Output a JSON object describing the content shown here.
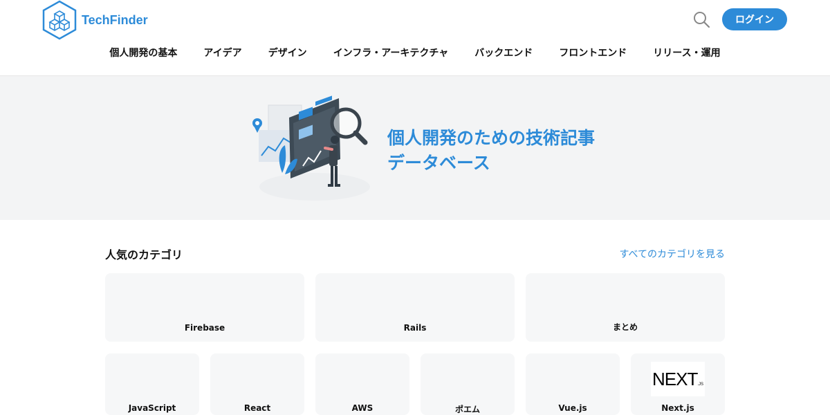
{
  "header": {
    "brand": "TechFinder",
    "login_label": "ログイン",
    "brand_color": "#2d8bd8"
  },
  "nav": {
    "items": [
      {
        "label": "個人開発の基本"
      },
      {
        "label": "アイデア"
      },
      {
        "label": "デザイン"
      },
      {
        "label": "インフラ・アーキテクチャ"
      },
      {
        "label": "バックエンド"
      },
      {
        "label": "フロントエンド"
      },
      {
        "label": "リリース・運用"
      }
    ]
  },
  "hero": {
    "title_line1": "個人開発のための技術記事",
    "title_line2": "データベース"
  },
  "categories": {
    "heading": "人気のカテゴリ",
    "see_all_label": "すべてのカテゴリを見る",
    "row1": [
      {
        "label": "Firebase"
      },
      {
        "label": "Rails"
      },
      {
        "label": "まとめ"
      }
    ],
    "row2": [
      {
        "label": "JavaScript"
      },
      {
        "label": "React"
      },
      {
        "label": "AWS"
      },
      {
        "label": "ポエム"
      },
      {
        "label": "Vue.js"
      },
      {
        "label": "Next.js",
        "logo_text": "NEXT",
        "logo_suffix": ".JS"
      }
    ]
  },
  "icons": [
    "cube-logo-icon",
    "search-icon"
  ]
}
